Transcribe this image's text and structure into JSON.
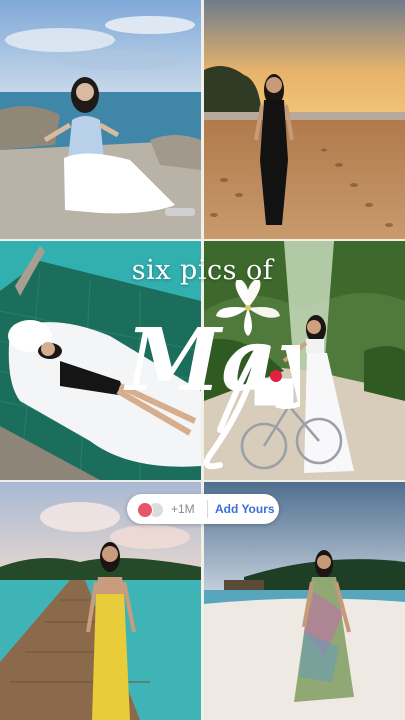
{
  "overlay": {
    "subtitle": "six pics of",
    "month": "May"
  },
  "add_yours_sticker": {
    "count": "+1M",
    "button_label": "Add Yours"
  },
  "photos": [
    {
      "id": "photo-1",
      "scene": "woman in blue dress sitting on rocks by sea"
    },
    {
      "id": "photo-2",
      "scene": "woman in black dress on beach at sunset"
    },
    {
      "id": "photo-3",
      "scene": "woman lying on net over lagoon"
    },
    {
      "id": "photo-4",
      "scene": "woman with bicycle on tropical path"
    },
    {
      "id": "photo-5",
      "scene": "woman in yellow dress on wooden pier"
    },
    {
      "id": "photo-6",
      "scene": "woman in floral dress on white sand beach"
    }
  ],
  "colors": {
    "button_text": "#3b6fd6",
    "avatar_accent": "#e8566a",
    "title_text": "#ffffff"
  }
}
